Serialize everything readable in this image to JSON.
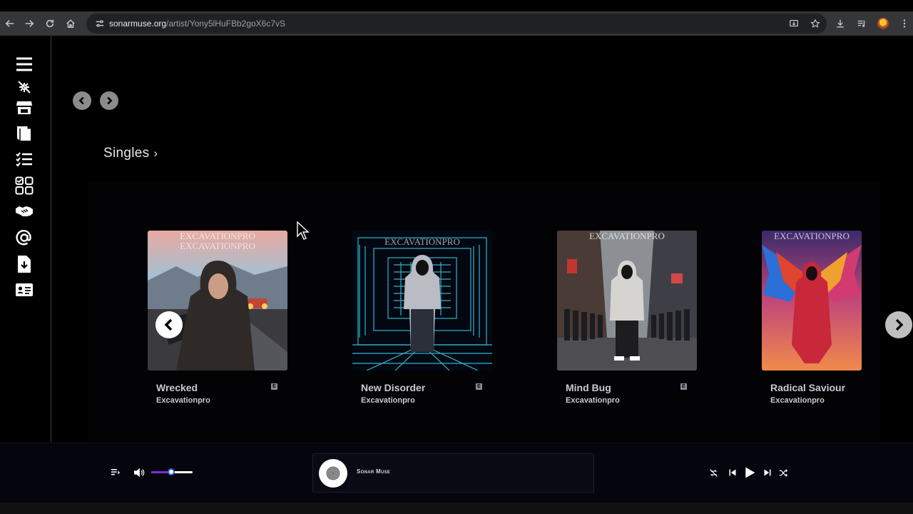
{
  "browser": {
    "url_host": "sonarmuse.org",
    "url_path": "/artist/Yony5lHuFBb2goX6c7vS"
  },
  "sidebar": {
    "items": [
      {
        "icon": "menu-icon"
      },
      {
        "icon": "discover-icon"
      },
      {
        "icon": "store-icon"
      },
      {
        "icon": "book-icon"
      },
      {
        "icon": "list-icon"
      },
      {
        "icon": "apps-icon"
      },
      {
        "icon": "handshake-icon"
      },
      {
        "icon": "at-icon"
      },
      {
        "icon": "download-icon"
      },
      {
        "icon": "id-card-icon"
      }
    ]
  },
  "section": {
    "title": "Singles",
    "chevron": "›"
  },
  "singles": [
    {
      "title": "Wrecked",
      "artist": "Excavationpro",
      "explicit": "E"
    },
    {
      "title": "New Disorder",
      "artist": "Excavationpro",
      "explicit": "E"
    },
    {
      "title": "Mind Bug",
      "artist": "Excavationpro",
      "explicit": "E"
    },
    {
      "title": "Radical Saviour",
      "artist": "Excavationpro",
      "explicit": ""
    }
  ],
  "cover_text": "EXCAVATIONPRO",
  "player": {
    "now_playing": "Sonar Muse",
    "volume": 0.48
  },
  "colors": {
    "accent": "#7d2ad9",
    "chrome": "#35363a",
    "omnibox": "#202124"
  }
}
